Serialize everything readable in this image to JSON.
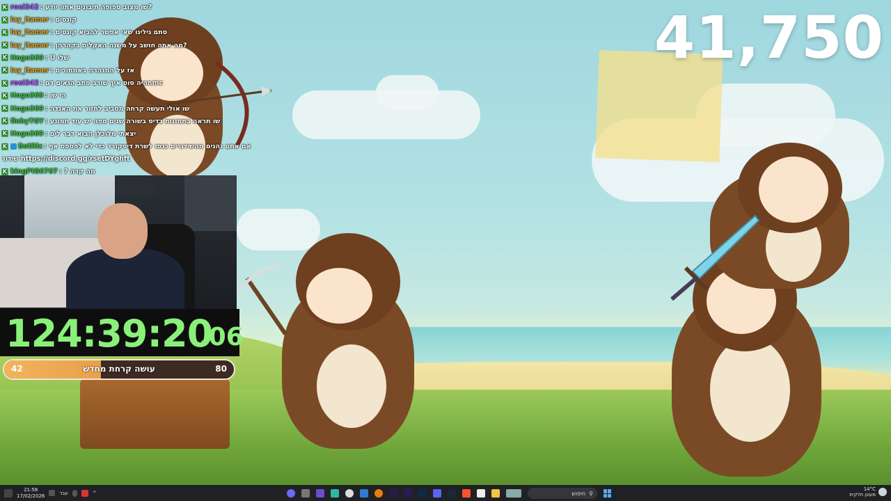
{
  "stream": {
    "score": "41,750",
    "timer": {
      "main": "124:39:20",
      "ms": ".06"
    },
    "progress": {
      "left": "42",
      "right": "80",
      "label": "עושה קרחת מחדש",
      "fraction": 0.42
    }
  },
  "chat": [
    {
      "badge": "K",
      "user": "roei342",
      "color": "#b04cff",
      "msg": "שו מצוב ספופה תיבונים אתה יודע?"
    },
    {
      "badge": "K",
      "user": "lay_itamer",
      "color": "#e8a020",
      "msg": "קונסים"
    },
    {
      "badge": "K",
      "user": "lay_itamer",
      "color": "#e8a020",
      "msg": "סתם גילינו שאי אפשר להביא קונסים"
    },
    {
      "badge": "K",
      "user": "lay_itamer",
      "color": "#e8a020",
      "msg": "מה אתה חושב על משנה האקלים בקהרהן?"
    },
    {
      "badge": "K",
      "user": "Hogo369",
      "color": "#3fc03f",
      "msg": "U שלו"
    },
    {
      "badge": "K",
      "user": "lay_itamer",
      "color": "#e8a020",
      "msg": "אז על המנהרה באמתורים"
    },
    {
      "badge": "K",
      "user": "roei342",
      "color": "#b04cff",
      "msg": "תהיה סוס איך שורב סתב הגאים דםmc"
    },
    {
      "badge": "K",
      "user": "Hogo369",
      "color": "#3fc03f",
      "msg": "הי שו"
    },
    {
      "badge": "K",
      "user": "Hogo369",
      "color": "#3fc03f",
      "msg": "שו אולי תעשה קרחה מסביב לחזור את האגדה"
    },
    {
      "badge": "K",
      "user": "finhyTGY",
      "color": "#3fc03f",
      "msg": "שו תראה בתמונות בדיס בשורה שנים מפה יש עוד חמונע"
    },
    {
      "badge": "K",
      "user": "Hogo369",
      "color": "#3fc03f",
      "msg": "יצאתי מלוכלן הבוא דבר לים"
    },
    {
      "badge": "K",
      "user": "BotRix",
      "color": "#3fc03f",
      "msg": "אם אתם נהנים מהשידורים כנסו לשרת דיסקורד כדי לא לפספס אף",
      "bot": true
    },
    {
      "badge": "",
      "user": "",
      "color": "#ffffff",
      "msg": "שידור https://discord.gg/rsetDYghft"
    },
    {
      "badge": "K",
      "user": "kingPIG6767",
      "color": "#3fc03f",
      "msg": "? מה קרה"
    }
  ],
  "taskbar": {
    "time": "21:58",
    "date": "17/02/2026",
    "lang": "עבר",
    "search_label": "חיפוש",
    "weather_temp": "14°C",
    "weather_desc": "מעונן חלקית"
  }
}
